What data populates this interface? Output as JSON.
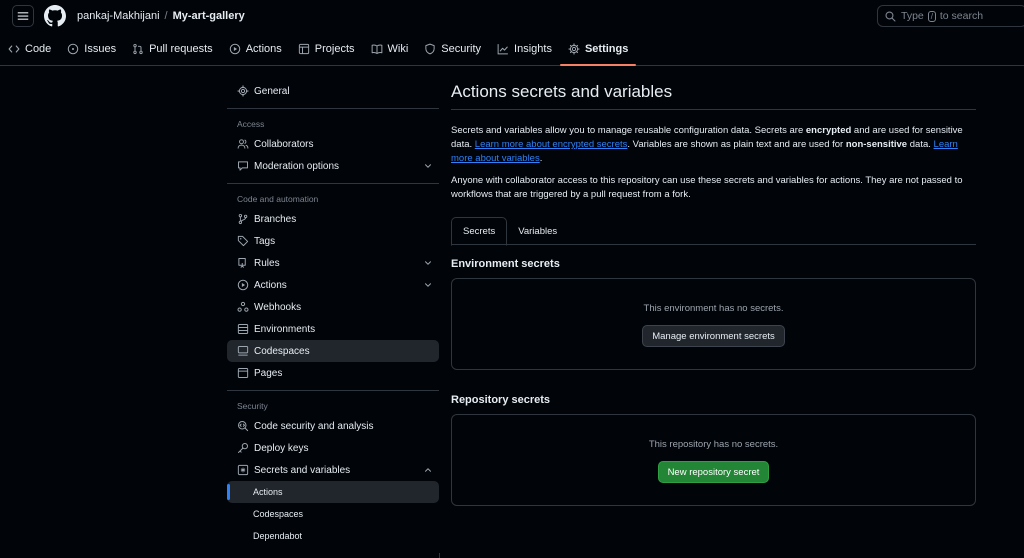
{
  "header": {
    "owner": "pankaj-Makhijani",
    "separator": "/",
    "repo": "My-art-gallery",
    "search_before": "Type",
    "search_key": "/",
    "search_after": "to search"
  },
  "tabs": [
    {
      "label": "Code",
      "icon": "code-icon"
    },
    {
      "label": "Issues",
      "icon": "issue-icon"
    },
    {
      "label": "Pull requests",
      "icon": "pull-request-icon"
    },
    {
      "label": "Actions",
      "icon": "play-icon"
    },
    {
      "label": "Projects",
      "icon": "table-icon"
    },
    {
      "label": "Wiki",
      "icon": "book-icon"
    },
    {
      "label": "Security",
      "icon": "shield-icon"
    },
    {
      "label": "Insights",
      "icon": "graph-icon"
    },
    {
      "label": "Settings",
      "icon": "gear-icon",
      "active": true
    }
  ],
  "sidebar": {
    "general": "General",
    "access_heading": "Access",
    "collaborators": "Collaborators",
    "moderation": "Moderation options",
    "code_heading": "Code and automation",
    "branches": "Branches",
    "tags": "Tags",
    "rules": "Rules",
    "actions": "Actions",
    "webhooks": "Webhooks",
    "environments": "Environments",
    "codespaces": "Codespaces",
    "pages": "Pages",
    "security_heading": "Security",
    "code_security": "Code security and analysis",
    "deploy_keys": "Deploy keys",
    "secrets_vars": "Secrets and variables",
    "sub_actions": "Actions",
    "sub_codespaces": "Codespaces",
    "sub_dependabot": "Dependabot"
  },
  "main": {
    "title": "Actions secrets and variables",
    "p1_a": "Secrets and variables allow you to manage reusable configuration data. Secrets are ",
    "p1_b": "encrypted",
    "p1_c": " and are used for sensitive data. ",
    "p1_link1": "Learn more about encrypted secrets",
    "p1_d": ". Variables are shown as plain text and are used for ",
    "p1_e": "non-sensitive",
    "p1_f": " data. ",
    "p1_link2": "Learn more about variables",
    "p1_g": ".",
    "p2": "Anyone with collaborator access to this repository can use these secrets and variables for actions. They are not passed to workflows that are triggered by a pull request from a fork.",
    "subtab_secrets": "Secrets",
    "subtab_variables": "Variables",
    "env_heading": "Environment secrets",
    "env_empty": "This environment has no secrets.",
    "env_button": "Manage environment secrets",
    "repo_heading": "Repository secrets",
    "repo_empty": "This repository has no secrets.",
    "repo_button": "New repository secret"
  },
  "colors": {
    "background": "#010409",
    "border": "#30363d",
    "accent_tab": "#f78166",
    "link": "#2f81f7",
    "green_button": "#238636"
  }
}
